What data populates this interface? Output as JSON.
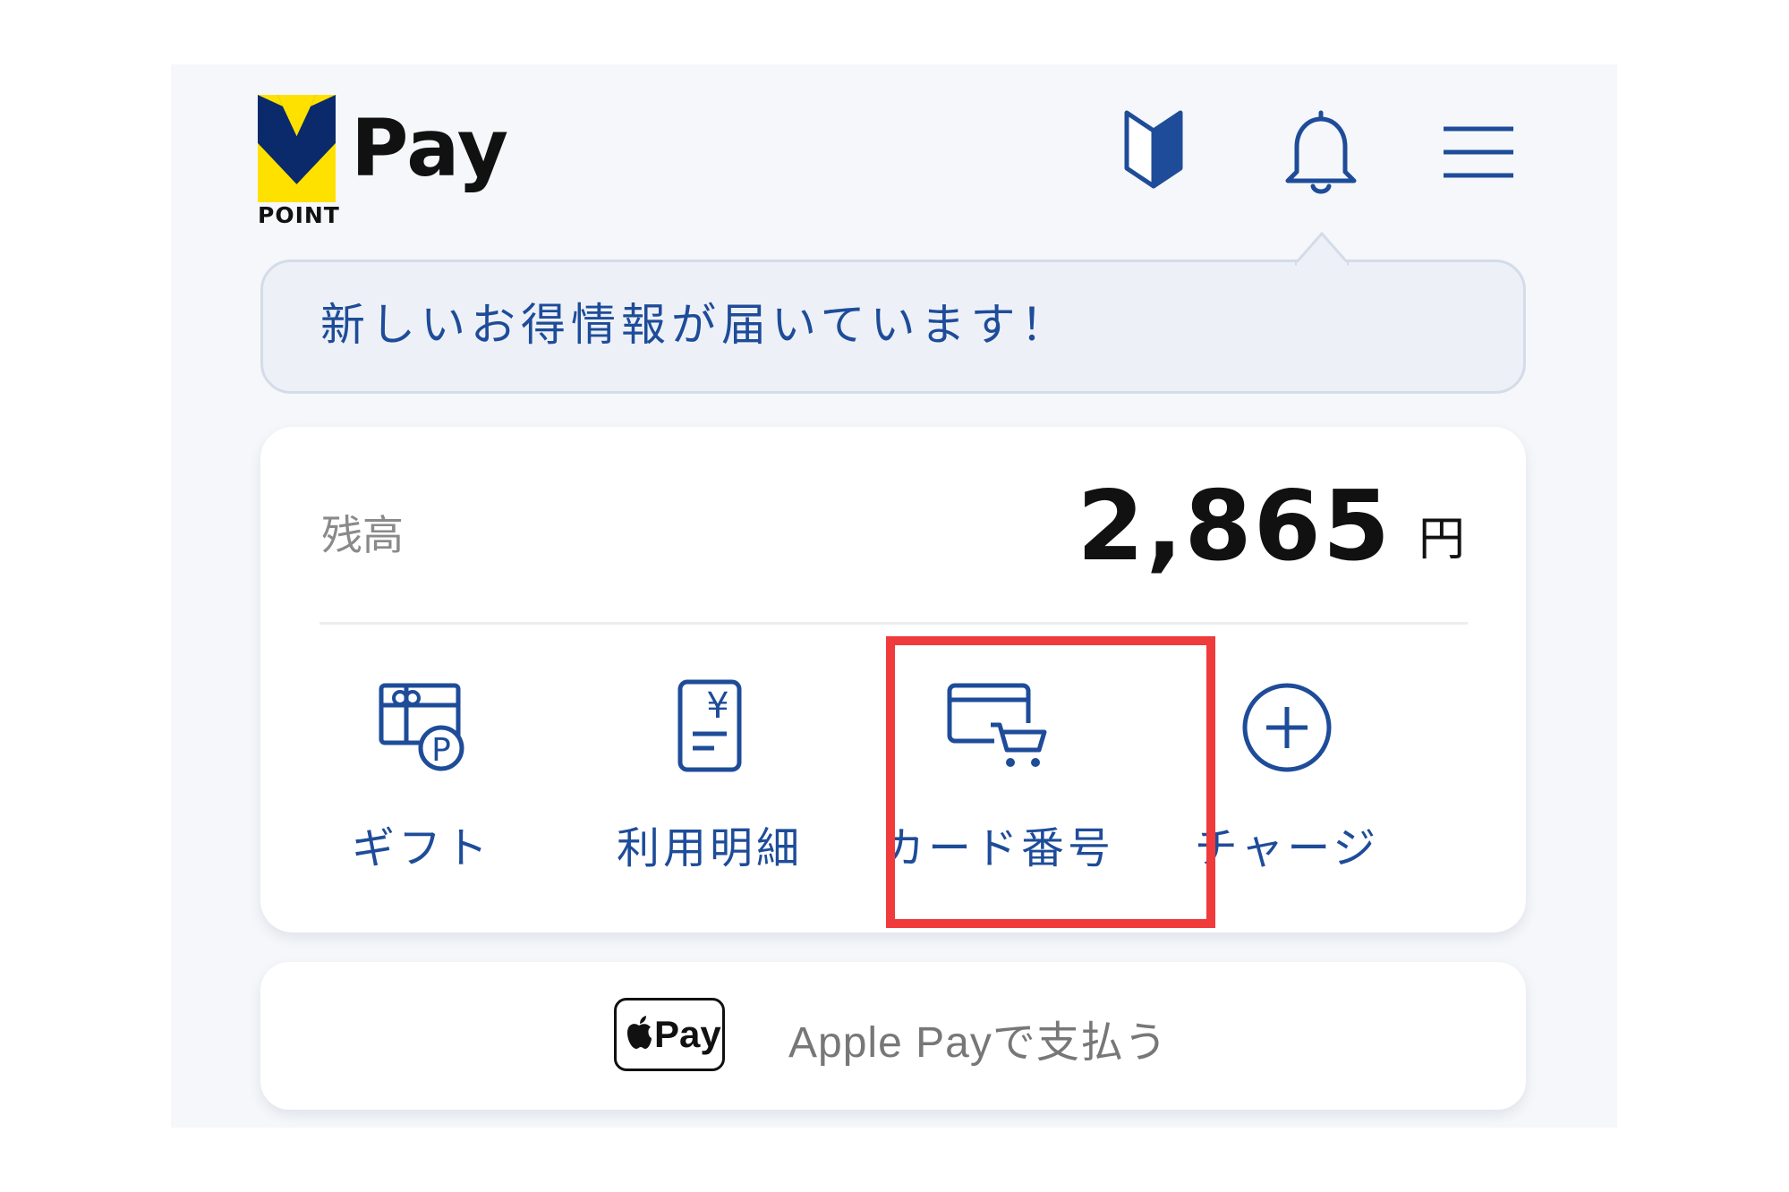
{
  "brand": {
    "logo_point": "POINT",
    "logo_pay": "Pay",
    "colors": {
      "yellow": "#ffe100",
      "navy": "#1e4c99",
      "dark": "#0b2a6b"
    }
  },
  "header": {
    "icons": [
      "guide-icon",
      "bell-icon",
      "menu-icon"
    ]
  },
  "notice": {
    "text": "新しいお得情報が届いています！"
  },
  "balance": {
    "label": "残高",
    "amount": "2,865",
    "unit": "円"
  },
  "actions": [
    {
      "label": "ギフト",
      "icon": "gift-point-icon"
    },
    {
      "label": "利用明細",
      "icon": "statement-icon"
    },
    {
      "label": "カード番号",
      "icon": "card-cart-icon",
      "highlighted": true
    },
    {
      "label": "チャージ",
      "icon": "plus-circle-icon"
    }
  ],
  "applepay": {
    "badge": "Pay",
    "label": "Apple Payで支払う"
  },
  "highlight_color": "#ef3b3c"
}
